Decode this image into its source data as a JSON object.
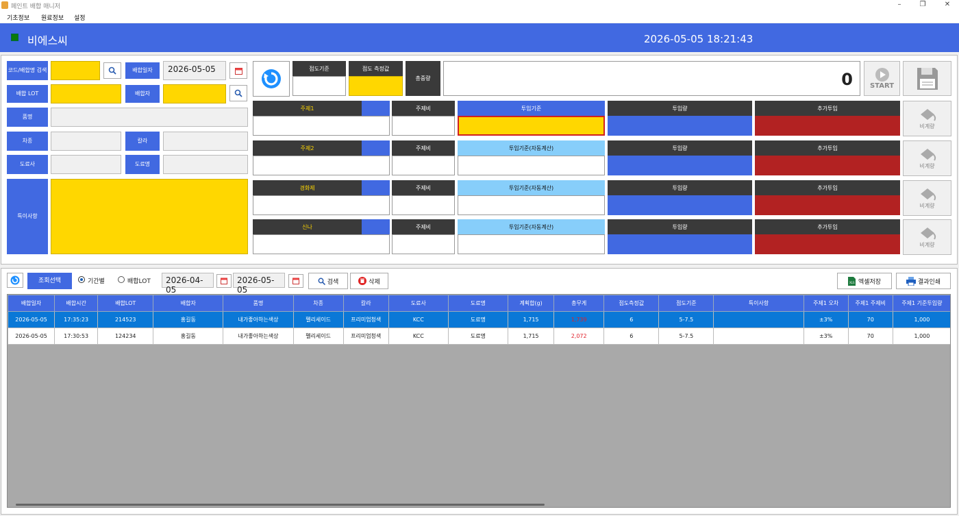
{
  "window": {
    "title": "페인트 배합 매니저",
    "min": "–",
    "max": "❐",
    "close": "✕"
  },
  "menu": [
    "기초정보",
    "원료정보",
    "설정"
  ],
  "header": {
    "company": "비에스씨",
    "datetime": "2026-05-05  18:21:43"
  },
  "form": {
    "code_search_label": "코드/배합명 검색",
    "mix_date_label": "배합일자",
    "mix_date_value": "2026-05-05",
    "lot_label": "배합 LOT",
    "mixer_label": "배합자",
    "product_label": "품명",
    "car_label": "차종",
    "color_label": "칼라",
    "paint_co_label": "도료사",
    "paint_name_label": "도료명",
    "notes_label": "특이사항"
  },
  "measure": {
    "viscosity_std_label": "점도기준",
    "viscosity_meas_label": "점도 측정값",
    "total_weight_label": "총중량",
    "total_weight_value": "0",
    "start_label": "START"
  },
  "rows": [
    {
      "name": "주제1",
      "ratio": "주제비",
      "std": "투입기준",
      "input": "투입량",
      "extra": "추가투입",
      "btn": "비계량"
    },
    {
      "name": "주제2",
      "ratio": "주제비",
      "std": "투입기준(자동계산)",
      "input": "투입량",
      "extra": "추가투입",
      "btn": "비계량"
    },
    {
      "name": "경화제",
      "ratio": "주제비",
      "std": "투입기준(자동계산)",
      "input": "투입량",
      "extra": "추가투입",
      "btn": "비계량"
    },
    {
      "name": "신나",
      "ratio": "주제비",
      "std": "투입기준(자동계산)",
      "input": "투입량",
      "extra": "추가투입",
      "btn": "비계량"
    }
  ],
  "query": {
    "select_label": "조회선택",
    "period_label": "기간별",
    "lot_label": "배합LOT",
    "date_from": "2026-04-05",
    "date_to": "2026-05-05",
    "search_label": "검색",
    "delete_label": "삭제",
    "excel_label": "엑셀저장",
    "print_label": "결과인쇄"
  },
  "table": {
    "columns": [
      "배합일자",
      "배합시간",
      "배합LOT",
      "배합자",
      "품명",
      "차종",
      "칼라",
      "도료사",
      "도료명",
      "계획합(g)",
      "총무게",
      "점도측정값",
      "점도기준",
      "특이사항",
      "주제1 오차",
      "주제1 주제비",
      "주제1 기준투입량"
    ],
    "rows": [
      [
        "2026-05-05",
        "17:35:23",
        "214523",
        "홍길동",
        "내가좋아하는색상",
        "펠리세이드",
        "프리미엄청색",
        "KCC",
        "도료명",
        "1,715",
        "1,739",
        "6",
        "5-7.5",
        "",
        "±3%",
        "70",
        "1,000"
      ],
      [
        "2026-05-05",
        "17:30:53",
        "124234",
        "홍길동",
        "내가좋아하는색상",
        "펠리세이드",
        "프리미엄청색",
        "KCC",
        "도료명",
        "1,715",
        "2,072",
        "6",
        "5-7.5",
        "",
        "±3%",
        "70",
        "1,000"
      ]
    ]
  },
  "colors": {
    "accent": "#4169e1",
    "yellow": "#ffd700",
    "red": "#b22222",
    "selected": "#0a78d7"
  }
}
